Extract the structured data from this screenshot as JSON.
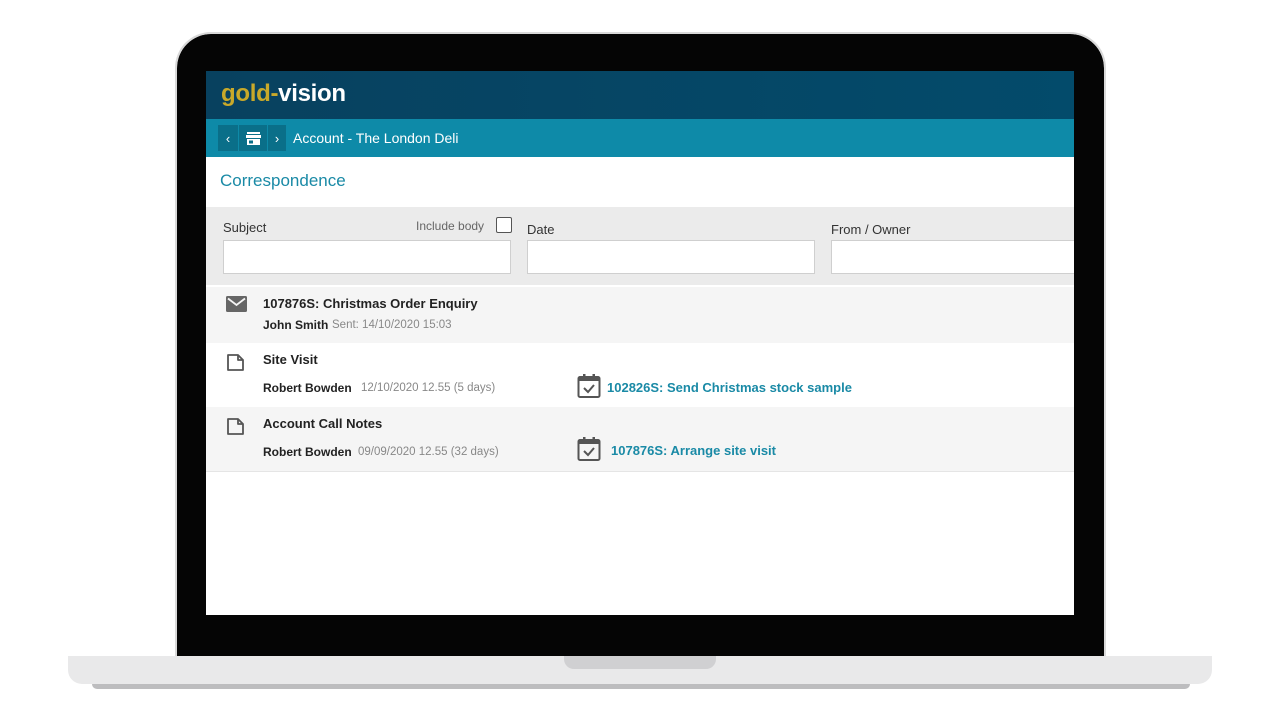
{
  "app": {
    "logo_gold": "gold",
    "logo_separator": "-",
    "logo_vision": "vision"
  },
  "breadcrumb": {
    "back_glyph": "‹",
    "forward_glyph": "›",
    "home_icon": "store-icon",
    "title": "Account - The London Deli"
  },
  "section": {
    "title": "Correspondence"
  },
  "filters": {
    "subject_label": "Subject",
    "include_body_label": "Include body",
    "include_body_checked": false,
    "date_label": "Date",
    "from_owner_label": "From / Owner",
    "subject_value": "",
    "date_value": "",
    "from_owner_value": ""
  },
  "rows": [
    {
      "icon": "mail-icon",
      "subject": "107876S: Christmas Order Enquiry",
      "owner": "John Smith",
      "meta": "Sent: 14/10/2020  15:03",
      "task": ""
    },
    {
      "icon": "document-icon",
      "subject": "Site Visit",
      "owner": "Robert Bowden",
      "meta": "12/10/2020  12.55 (5 days)",
      "task": "102826S: Send Christmas stock sample"
    },
    {
      "icon": "document-icon",
      "subject": "Account Call Notes",
      "owner": "Robert Bowden",
      "meta": "09/09/2020  12.55 (32 days)",
      "task": "107876S: Arrange site visit"
    }
  ],
  "colors": {
    "header_dark": "#08415f",
    "header_teal": "#0e8aa8",
    "accent": "#1a8aa6",
    "logo_gold": "#c8a92a"
  }
}
